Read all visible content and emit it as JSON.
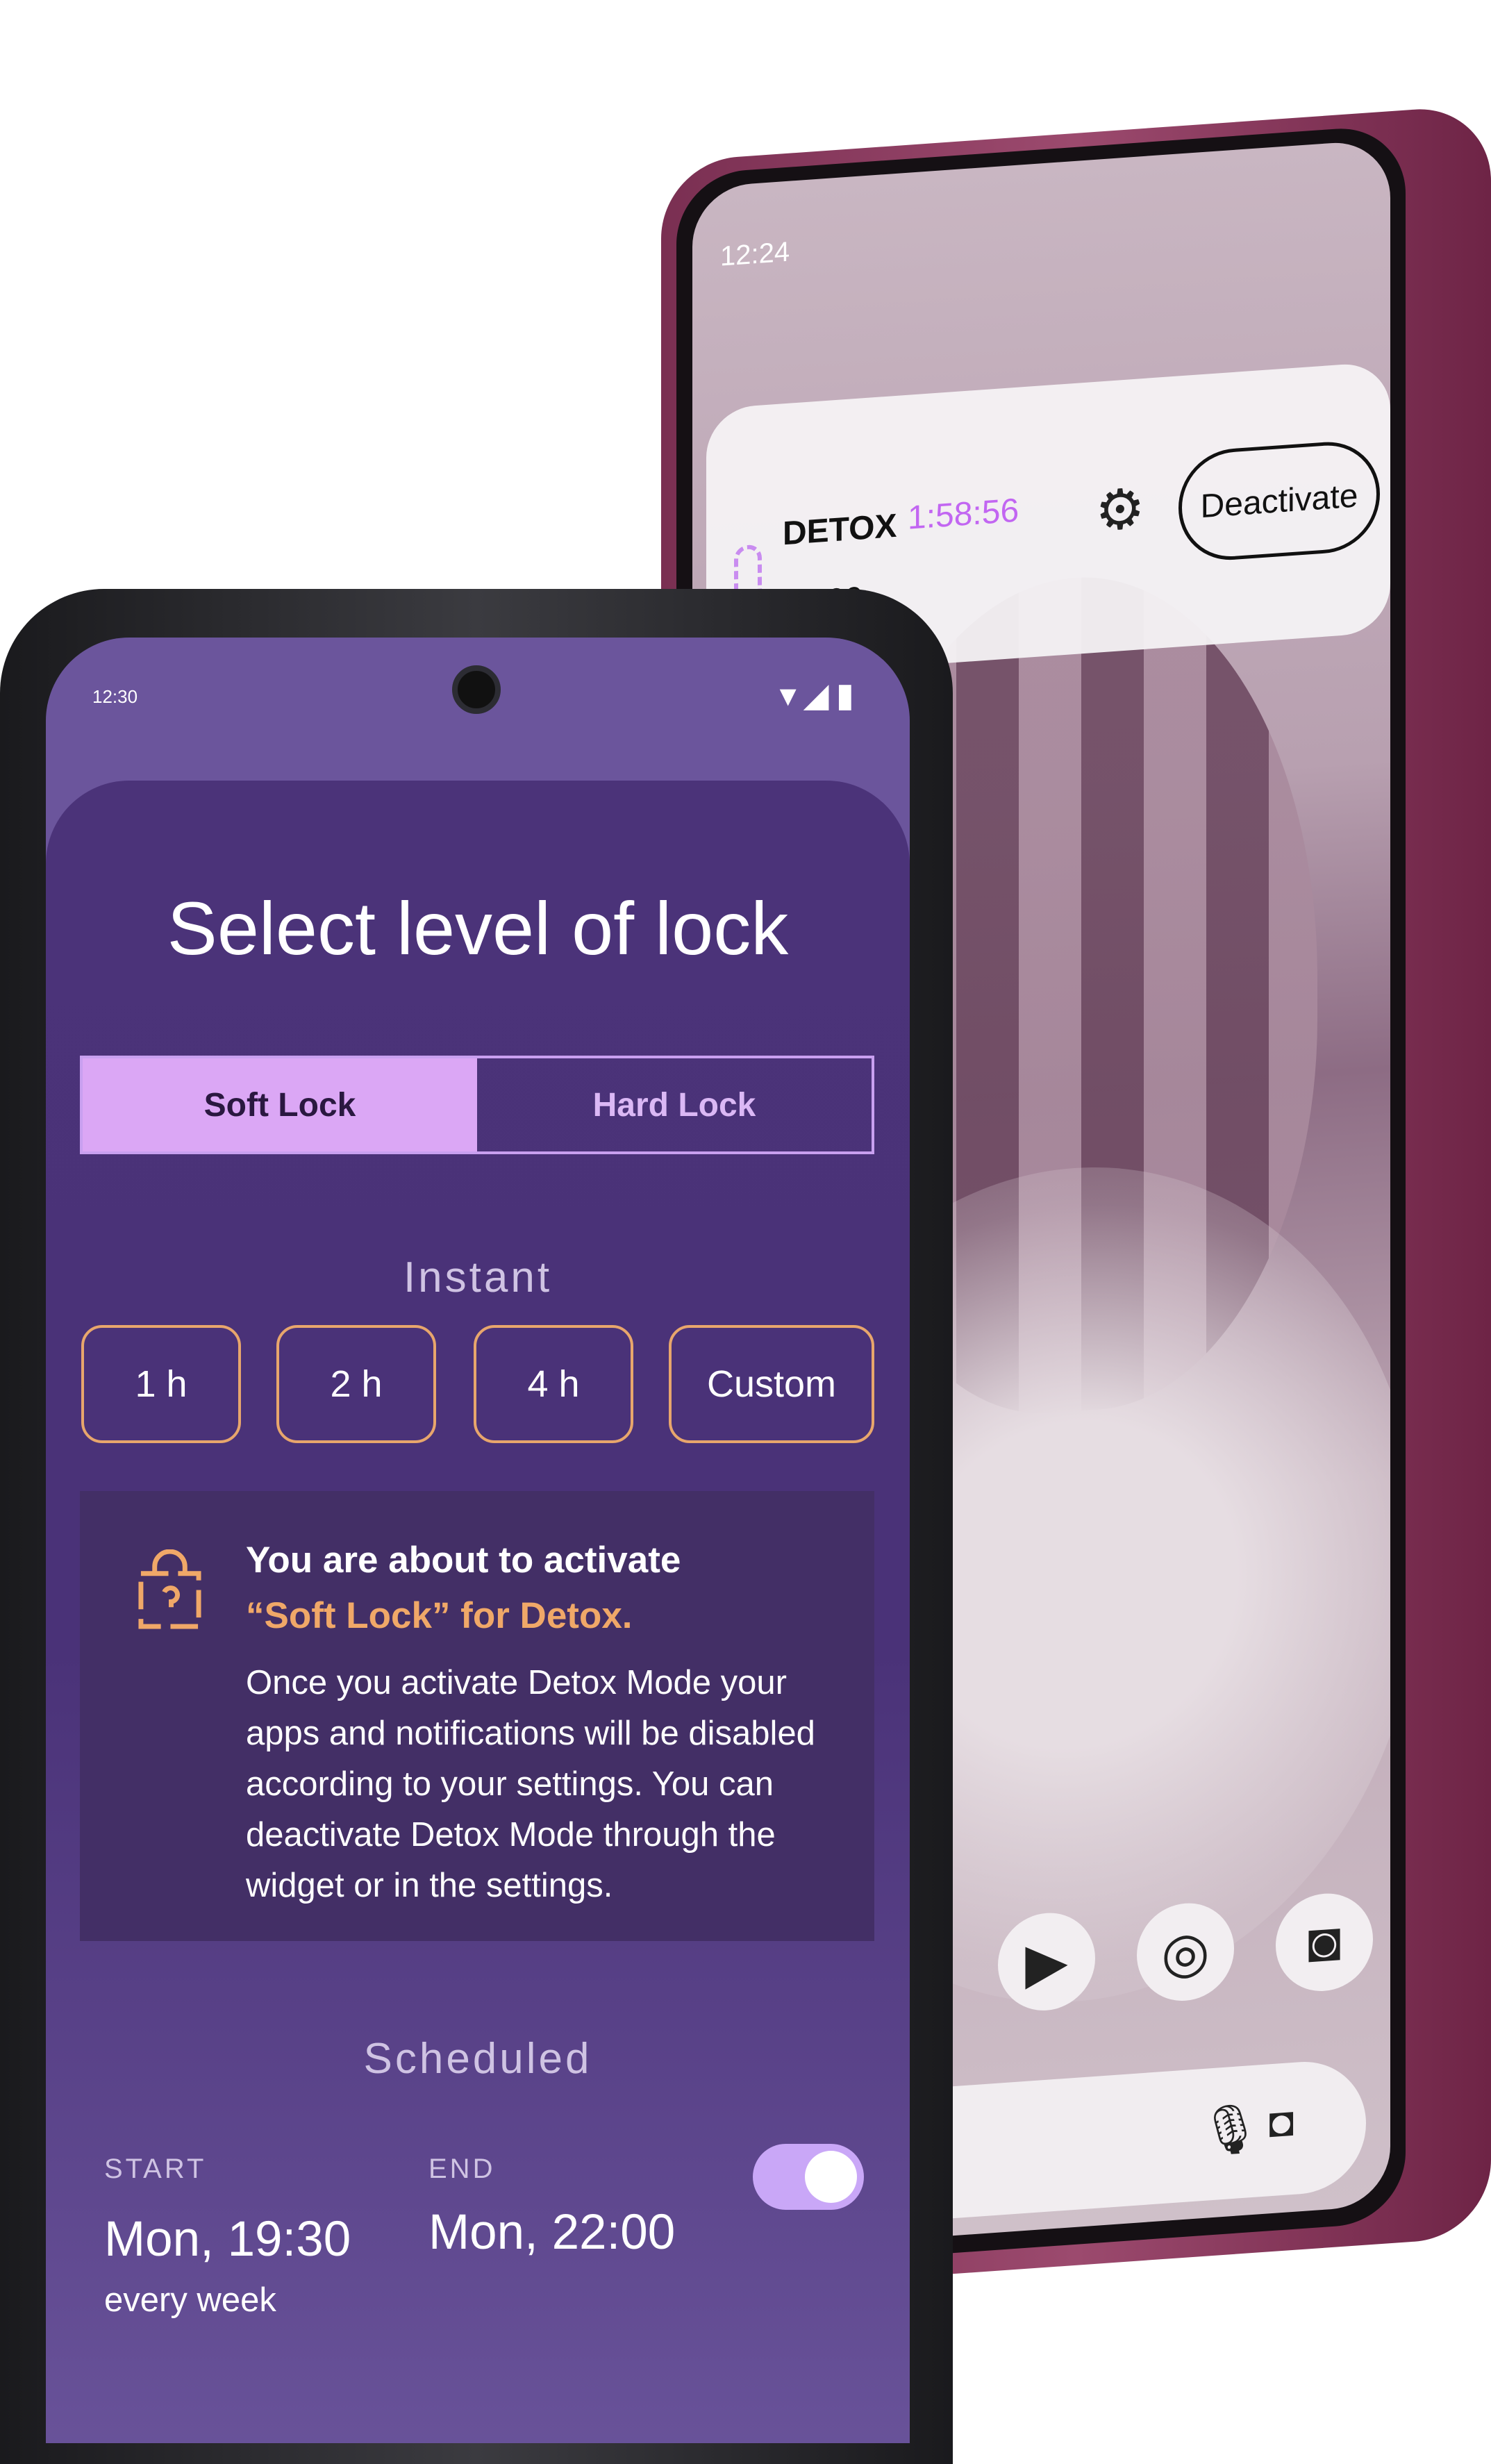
{
  "back_phone": {
    "status_time": "12:24",
    "widget": {
      "title": "DETOX",
      "timer": "1:58:56",
      "end_time": "16:00",
      "deactivate_label": "Deactivate",
      "timer_color": "#c266f2"
    },
    "dock_icons": [
      "play-store-icon",
      "chrome-icon",
      "camera-icon"
    ],
    "search_icons": [
      "mic-icon",
      "lens-icon"
    ]
  },
  "front_phone": {
    "status_time": "12:30",
    "title": "Select level of lock",
    "lock_tabs": [
      {
        "label": "Soft Lock",
        "selected": true
      },
      {
        "label": "Hard Lock",
        "selected": false
      }
    ],
    "instant": {
      "heading": "Instant",
      "options": [
        "1 h",
        "2 h",
        "4 h",
        "Custom"
      ]
    },
    "info": {
      "headline": "You are about to activate",
      "highlight": "“Soft Lock” for Detox.",
      "body": "Once you activate Detox Mode your apps and notifications will be disabled according to your settings. You can deactivate Detox Mode through the widget or in the settings."
    },
    "scheduled": {
      "heading": "Scheduled",
      "start_label": "START",
      "start_value": "Mon, 19:30",
      "repeat": "every week",
      "end_label": "END",
      "end_value": "Mon, 22:00",
      "enabled": true
    },
    "colors": {
      "accent": "#dba7f5",
      "orange": "#f0a868",
      "background": "#4b3379"
    }
  }
}
